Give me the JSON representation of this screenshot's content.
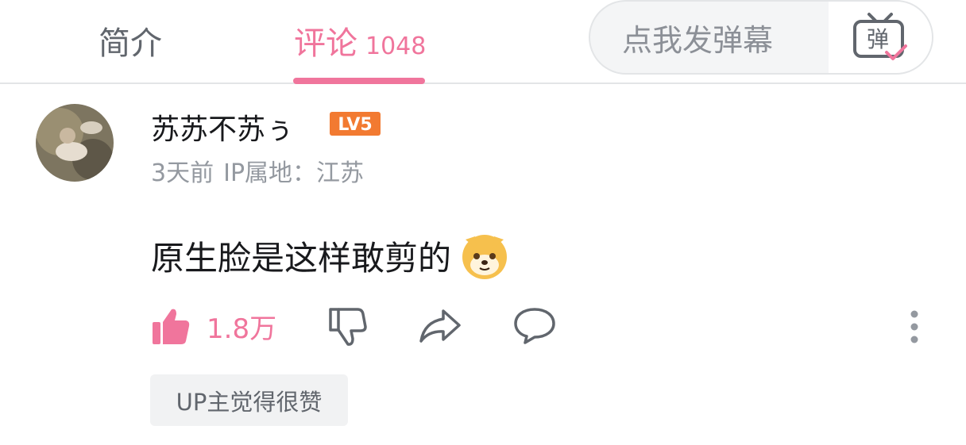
{
  "tabs": {
    "intro_label": "简介",
    "comments_label": "评论",
    "comments_count": "1048"
  },
  "danmaku": {
    "input_placeholder": "点我发弹幕",
    "toggle_label": "弹"
  },
  "comment": {
    "username": "苏苏不苏ぅ",
    "level_badge": "LV5",
    "time": "3天前",
    "ip_location": "IP属地：江苏",
    "text": "原生脸是这样敢剪的",
    "emoji": "doge-emoji",
    "like_count": "1.8万",
    "up_liked_label": "UP主觉得很赞"
  },
  "colors": {
    "accent_pink": "#f0759c",
    "level_orange": "#f27a31",
    "text_primary": "#18191c",
    "text_secondary": "#9499a0"
  },
  "icons": {
    "like": "thumbs-up-icon",
    "dislike": "thumbs-down-icon",
    "share": "share-arrow-icon",
    "reply": "speech-bubble-icon",
    "more": "vertical-dots-icon"
  }
}
